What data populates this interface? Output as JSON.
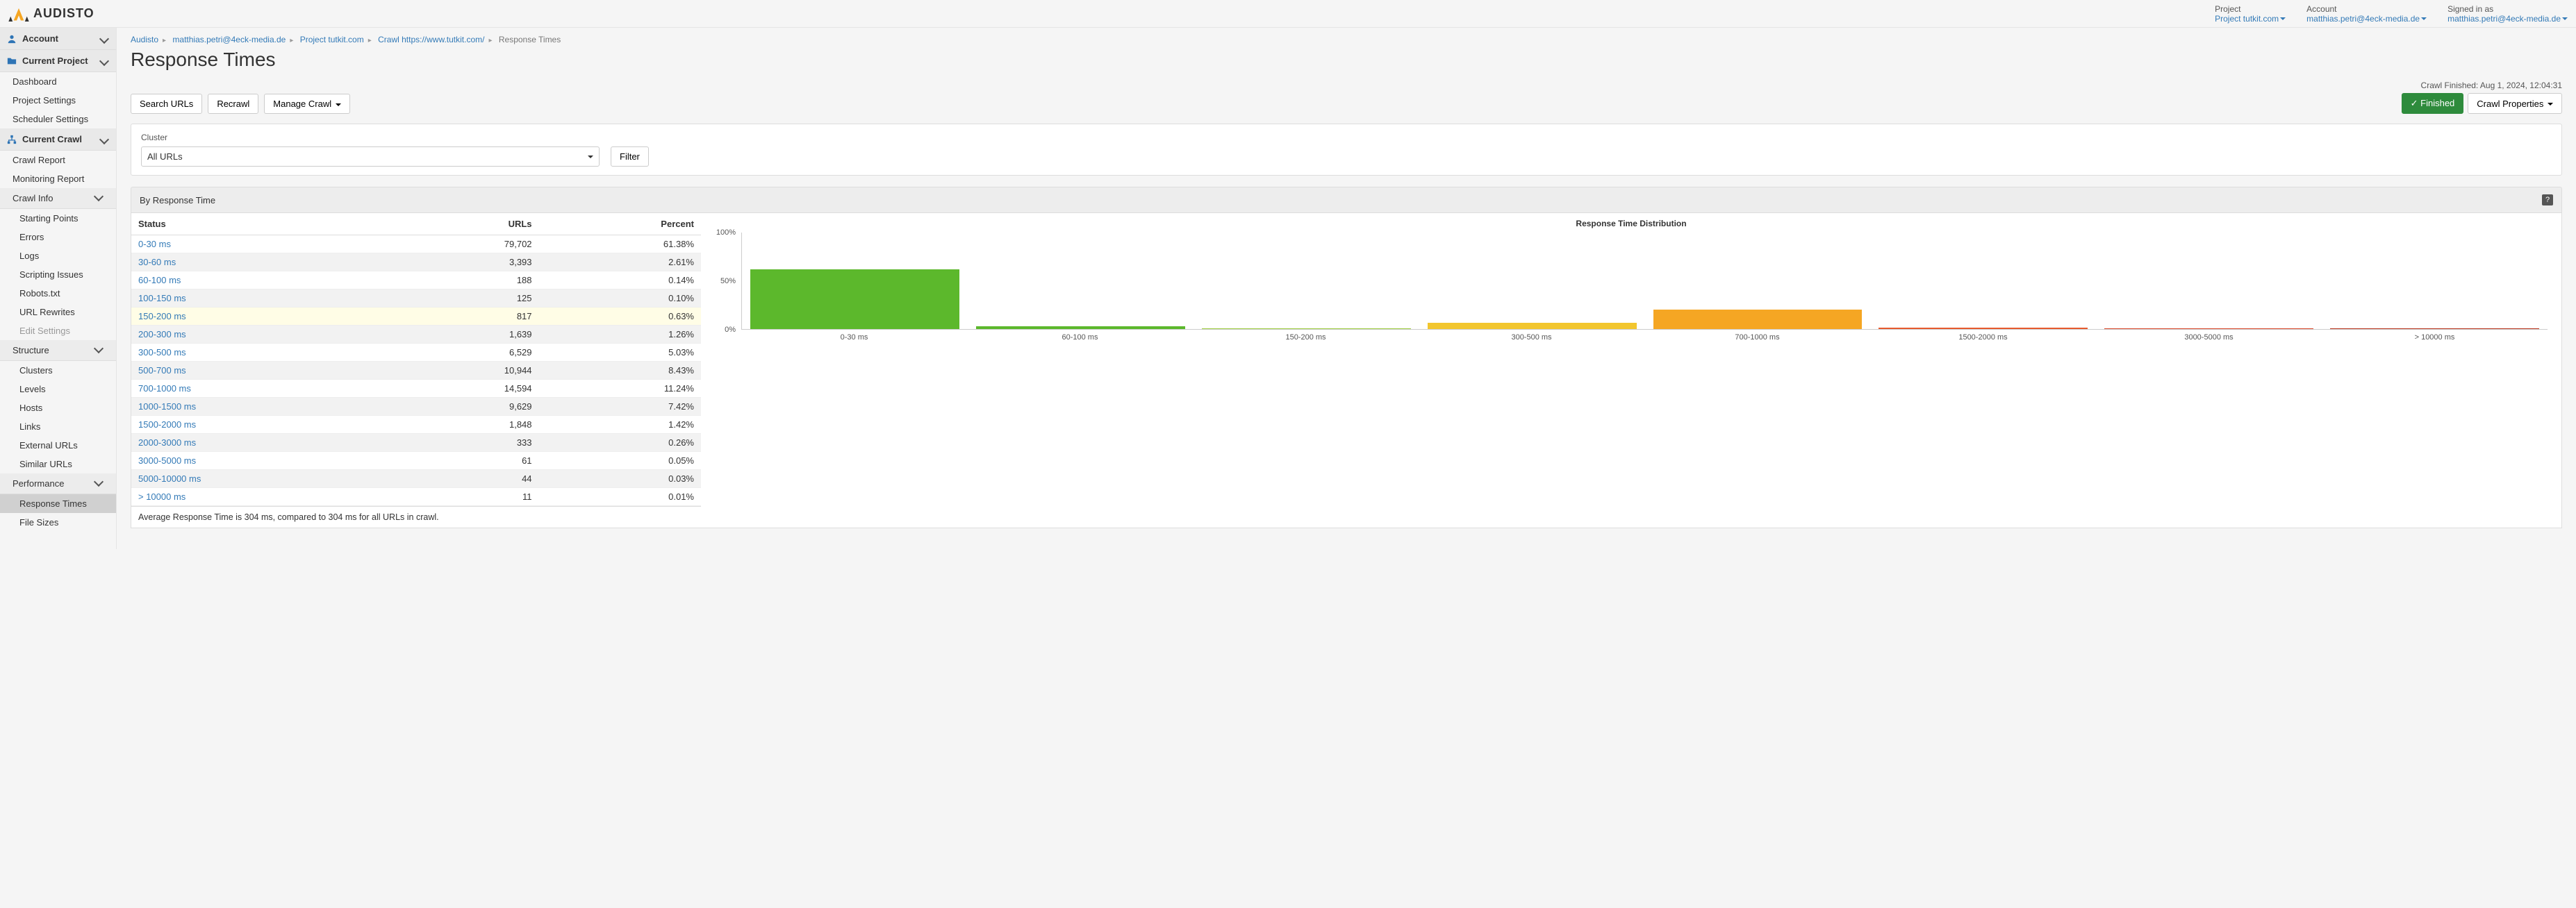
{
  "topbar": {
    "brand": "AUDISTO",
    "project_lbl": "Project",
    "project_val": "Project tutkit.com",
    "account_lbl": "Account",
    "account_val": "matthias.petri@4eck-media.de",
    "signed_lbl": "Signed in as",
    "signed_val": "matthias.petri@4eck-media.de"
  },
  "sidebar": {
    "account": "Account",
    "current_project": "Current Project",
    "proj_items": {
      "dashboard": "Dashboard",
      "settings": "Project Settings",
      "scheduler": "Scheduler Settings"
    },
    "current_crawl": "Current Crawl",
    "crawl_items": {
      "report": "Crawl Report",
      "monitoring": "Monitoring Report"
    },
    "crawl_info": "Crawl Info",
    "info_items": {
      "starting": "Starting Points",
      "errors": "Errors",
      "logs": "Logs",
      "scripting": "Scripting Issues",
      "robots": "Robots.txt",
      "rewrites": "URL Rewrites",
      "edit": "Edit Settings"
    },
    "structure": "Structure",
    "struct_items": {
      "clusters": "Clusters",
      "levels": "Levels",
      "hosts": "Hosts",
      "links": "Links",
      "external": "External URLs",
      "similar": "Similar URLs"
    },
    "performance": "Performance",
    "perf_items": {
      "response": "Response Times",
      "filesizes": "File Sizes"
    }
  },
  "breadcrumb": {
    "b0": "Audisto",
    "b1": "matthias.petri@4eck-media.de",
    "b2": "Project tutkit.com",
    "b3": "Crawl https://www.tutkit.com/",
    "b4": "Response Times"
  },
  "page_title": "Response Times",
  "toolbar": {
    "search": "Search URLs",
    "recrawl": "Recrawl",
    "manage": "Manage Crawl"
  },
  "finished": {
    "ts": "Crawl Finished: Aug 1, 2024, 12:04:31",
    "badge": "Finished",
    "props": "Crawl Properties"
  },
  "cluster": {
    "label": "Cluster",
    "value": "All URLs",
    "filter": "Filter"
  },
  "section_title": "By Response Time",
  "table": {
    "h_status": "Status",
    "h_urls": "URLs",
    "h_percent": "Percent",
    "rows": [
      {
        "status": "0-30 ms",
        "urls": "79,702",
        "percent": "61.38%"
      },
      {
        "status": "30-60 ms",
        "urls": "3,393",
        "percent": "2.61%"
      },
      {
        "status": "60-100 ms",
        "urls": "188",
        "percent": "0.14%"
      },
      {
        "status": "100-150 ms",
        "urls": "125",
        "percent": "0.10%"
      },
      {
        "status": "150-200 ms",
        "urls": "817",
        "percent": "0.63%",
        "hl": true
      },
      {
        "status": "200-300 ms",
        "urls": "1,639",
        "percent": "1.26%"
      },
      {
        "status": "300-500 ms",
        "urls": "6,529",
        "percent": "5.03%"
      },
      {
        "status": "500-700 ms",
        "urls": "10,944",
        "percent": "8.43%"
      },
      {
        "status": "700-1000 ms",
        "urls": "14,594",
        "percent": "11.24%"
      },
      {
        "status": "1000-1500 ms",
        "urls": "9,629",
        "percent": "7.42%"
      },
      {
        "status": "1500-2000 ms",
        "urls": "1,848",
        "percent": "1.42%"
      },
      {
        "status": "2000-3000 ms",
        "urls": "333",
        "percent": "0.26%"
      },
      {
        "status": "3000-5000 ms",
        "urls": "61",
        "percent": "0.05%"
      },
      {
        "status": "5000-10000 ms",
        "urls": "44",
        "percent": "0.03%"
      },
      {
        "status": "> 10000 ms",
        "urls": "11",
        "percent": "0.01%"
      }
    ]
  },
  "avg_text": "Average Response Time is 304 ms, compared to 304 ms for all URLs in crawl.",
  "chart_data": {
    "type": "bar",
    "title": "Response Time Distribution",
    "ylabel": "",
    "xlabel": "",
    "ylim": [
      0,
      100
    ],
    "yticks": [
      0,
      50,
      100
    ],
    "ytick_labels": [
      "0%",
      "50%",
      "100%"
    ],
    "categories": [
      "0-30 ms",
      "60-100 ms",
      "150-200 ms",
      "300-500 ms",
      "700-1000 ms",
      "1500-2000 ms",
      "3000-5000 ms",
      "> 10000 ms"
    ],
    "series": [
      {
        "name": "percent",
        "values": [
          61.38,
          2.75,
          0.73,
          6.29,
          19.67,
          1.68,
          0.08,
          0.01
        ],
        "colors": [
          "#5cb82c",
          "#5cb82c",
          "#9ccc3c",
          "#f2c62e",
          "#f5a623",
          "#e65a2d",
          "#d94426",
          "#b83018"
        ]
      }
    ]
  }
}
